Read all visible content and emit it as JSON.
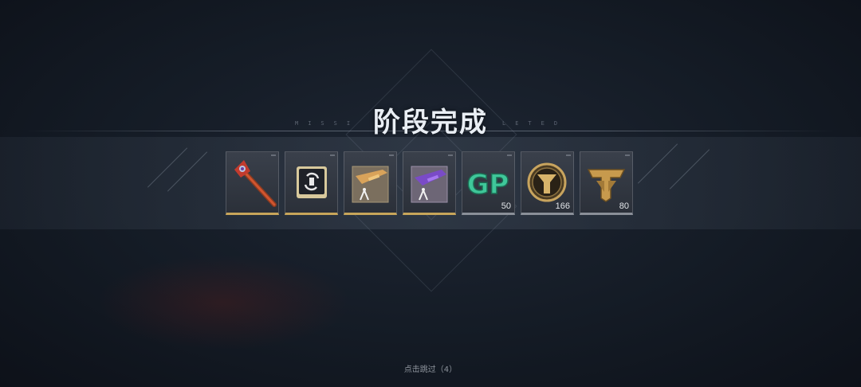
{
  "title": "阶段完成",
  "subtitle_left": "MISSI",
  "subtitle_right": "LETED",
  "skip_text": "点击跳过（4）",
  "rewards": [
    {
      "name": "magic-staff",
      "rarity": "gold",
      "count": ""
    },
    {
      "name": "swap-card",
      "rarity": "gold",
      "count": ""
    },
    {
      "name": "gold-rifle-blueprint",
      "rarity": "gold",
      "count": ""
    },
    {
      "name": "purple-rifle-blueprint",
      "rarity": "gold",
      "count": ""
    },
    {
      "name": "gp-currency",
      "rarity": "gray",
      "count": "50"
    },
    {
      "name": "badge-coin",
      "rarity": "gray",
      "count": "166"
    },
    {
      "name": "emblem-token",
      "rarity": "gray",
      "count": "80"
    }
  ],
  "colors": {
    "gold_bar": "#c7a55a",
    "gray_bar": "#8a8f98",
    "gp_green": "#3fc79a"
  }
}
